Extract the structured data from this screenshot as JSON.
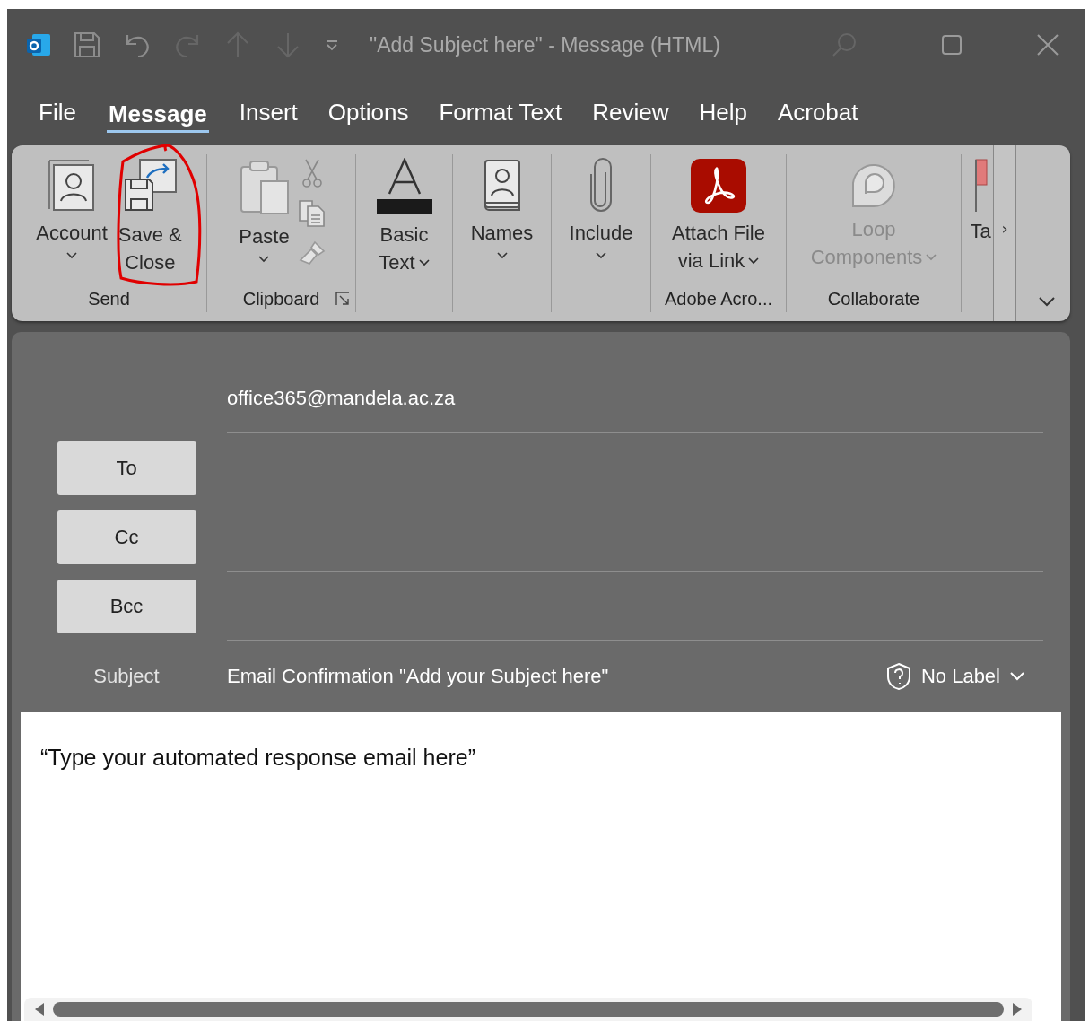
{
  "window": {
    "title": "\"Add Subject here\"  -  Message (HTML)"
  },
  "menu_tabs": [
    {
      "label": "File",
      "selected": false
    },
    {
      "label": "Message",
      "selected": true
    },
    {
      "label": "Insert",
      "selected": false
    },
    {
      "label": "Options",
      "selected": false
    },
    {
      "label": "Format Text",
      "selected": false
    },
    {
      "label": "Review",
      "selected": false
    },
    {
      "label": "Help",
      "selected": false
    },
    {
      "label": "Acrobat",
      "selected": false
    }
  ],
  "ribbon": {
    "groups": [
      {
        "label": "Send",
        "commands": [
          {
            "kind": "account",
            "lines": [
              "Account"
            ],
            "dropdown": true,
            "disabled": false
          },
          {
            "kind": "save-close",
            "lines": [
              "Save &",
              "Close"
            ],
            "dropdown": false,
            "disabled": false
          }
        ]
      },
      {
        "label": "Clipboard",
        "launcher": true,
        "commands": [
          {
            "kind": "paste",
            "lines": [
              "Paste"
            ],
            "dropdown": true,
            "disabled": false
          },
          {
            "kind": "clipboard-tools"
          }
        ]
      },
      {
        "commands": [
          {
            "kind": "basic-text",
            "lines": [
              "Basic",
              "Text"
            ],
            "dropdown": true,
            "disabled": false
          }
        ]
      },
      {
        "commands": [
          {
            "kind": "names",
            "lines": [
              "Names"
            ],
            "dropdown": true,
            "disabled": false
          }
        ]
      },
      {
        "commands": [
          {
            "kind": "include",
            "lines": [
              "Include"
            ],
            "dropdown": true,
            "disabled": false
          }
        ]
      },
      {
        "label": "Adobe Acro...",
        "commands": [
          {
            "kind": "pdf",
            "lines": [
              "Attach File",
              "via Link"
            ],
            "dropdown": true,
            "disabled": false
          }
        ]
      },
      {
        "label": "Collaborate",
        "commands": [
          {
            "kind": "loop",
            "lines": [
              "Loop",
              "Components"
            ],
            "dropdown": true,
            "disabled": true
          }
        ]
      },
      {
        "commands": [
          {
            "kind": "flag",
            "lines": [
              "Ta"
            ],
            "dropdown": false,
            "disabled": false
          }
        ]
      }
    ],
    "scroll_button": "›"
  },
  "compose": {
    "from": "office365@mandela.ac.za",
    "recipients": [
      {
        "button": "To"
      },
      {
        "button": "Cc"
      },
      {
        "button": "Bcc"
      }
    ],
    "subject_label": "Subject",
    "subject": "Email Confirmation \"Add your Subject here\"",
    "sensitivity": "No Label"
  },
  "body": "“Type your automated response email here”"
}
